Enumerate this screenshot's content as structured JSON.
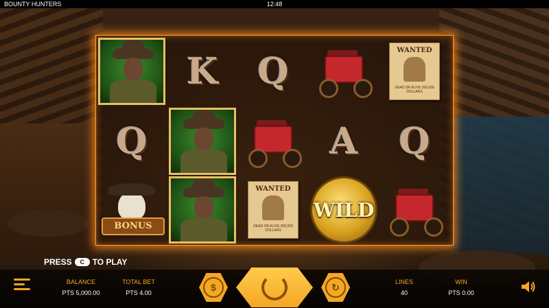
{
  "topbar": {
    "title": "BOUNTY HUNTERS",
    "clock": "12:48"
  },
  "reels": [
    [
      "hunter",
      "Q",
      "bonus"
    ],
    [
      "K",
      "hunter",
      "hunter"
    ],
    [
      "Q",
      "stagecoach",
      "wanted"
    ],
    [
      "stagecoach",
      "A",
      "wild"
    ],
    [
      "wanted",
      "Q",
      "stagecoach"
    ]
  ],
  "symbols": {
    "K": "K",
    "Q": "Q",
    "A": "A",
    "wanted_text": "WANTED",
    "wanted_reward": "DEAD OR ALIVE 200,000 DOLLARS",
    "wild": "WILD",
    "bonus": "BONUS"
  },
  "press": {
    "prefix": "PRESS",
    "key": "C",
    "suffix": "TO PLAY"
  },
  "stats": {
    "balance": {
      "label": "BALANCE",
      "value": "PTS 5,000.00"
    },
    "total_bet": {
      "label": "TOTAL BET",
      "value": "PTS 4.00"
    },
    "lines": {
      "label": "LINES",
      "value": "40"
    },
    "win": {
      "label": "WIN",
      "value": "PTS 0.00"
    }
  },
  "buttons": {
    "coin_symbol": "$",
    "autoplay_symbol": "↻"
  },
  "colors": {
    "accent": "#f5a623",
    "frame_glow": "#ff9a2a"
  }
}
